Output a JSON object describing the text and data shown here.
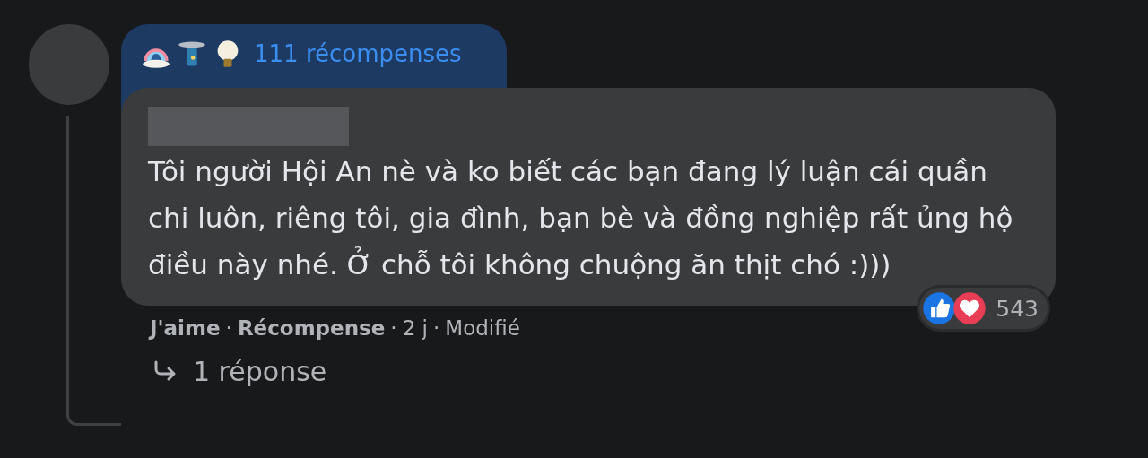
{
  "comment": {
    "awards": {
      "label": "111 récompenses"
    },
    "text": "Tôi người Hội An nè và ko biết các bạn đang lý luận cái quần chi luôn, riêng tôi, gia đình, bạn bè và đồng nghiệp rất ủng hộ điều này nhé. Ở chỗ tôi không chuộng ăn thịt chó :)))",
    "reactions": {
      "count": "543"
    },
    "separator": "·",
    "actions": [
      {
        "label": "J'aime",
        "bold": true
      },
      {
        "label": "Récompense",
        "bold": true
      },
      {
        "label": "2 j",
        "bold": false
      },
      {
        "label": "Modifié",
        "bold": false
      }
    ],
    "replies": {
      "label": "1 réponse"
    }
  }
}
